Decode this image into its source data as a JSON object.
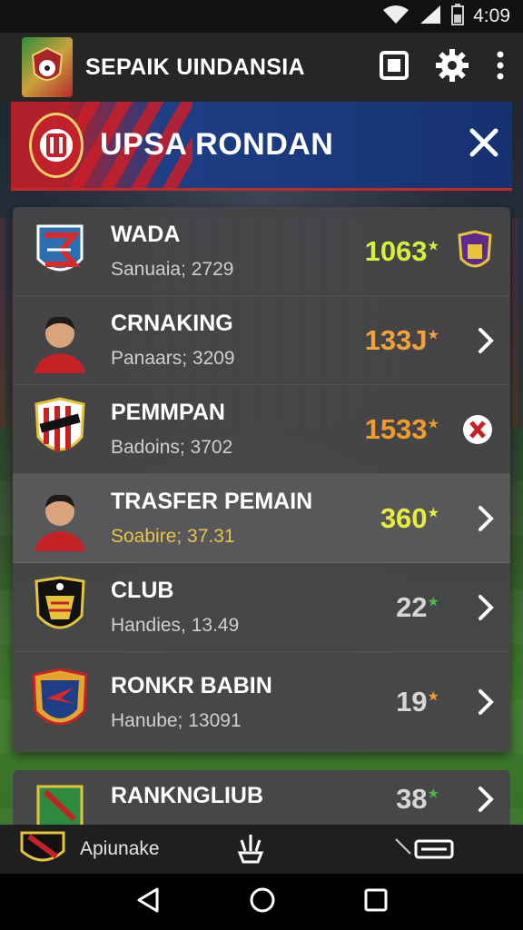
{
  "status_bar": {
    "time": "4:09"
  },
  "app_bar": {
    "title": "SEPAIK UINDANSIA",
    "icons": [
      "square-icon",
      "gear-icon",
      "more-vert-icon"
    ]
  },
  "banner": {
    "title": "UPSA RONDAN",
    "close_icon": "close-icon"
  },
  "list": {
    "items": [
      {
        "title": "WADA",
        "subtitle": "Sanuaia; 2729",
        "score": "1063",
        "score_color": "#d9f03a",
        "trailing": "club-crest-icon"
      },
      {
        "title": "CRNAKING",
        "subtitle": "Panaars; 3209",
        "score": "133J",
        "score_color": "#f3a23a",
        "trailing": "chevron-right-icon"
      },
      {
        "title": "PEMMPAN",
        "subtitle": "Badoins; 3702",
        "score": "1533",
        "score_color": "#f39b2a",
        "trailing": "badge-icon"
      },
      {
        "title": "TRASFER PEMAIN",
        "subtitle": "Soabire; 37.31",
        "score": "360",
        "score_color": "#e6f03a",
        "trailing": "chevron-right-icon"
      },
      {
        "title": "CLUB",
        "subtitle": "Handies, 13.49",
        "score": "22",
        "score_color": "#d6d6d6",
        "trailing": "chevron-right-icon"
      },
      {
        "title": "RONKR BABIN",
        "subtitle": "Hanube; 13091",
        "score": "19",
        "score_color": "#d6d6d6",
        "trailing": "chevron-right-icon"
      }
    ]
  },
  "second_card": {
    "title": "RANKNGLIUB",
    "score": "38"
  },
  "bottom_bar": {
    "label": "Apiunake"
  },
  "colors": {
    "accent_red": "#c02a2a",
    "banner_blue": "#1e3f86",
    "app_bar": "#262626"
  }
}
